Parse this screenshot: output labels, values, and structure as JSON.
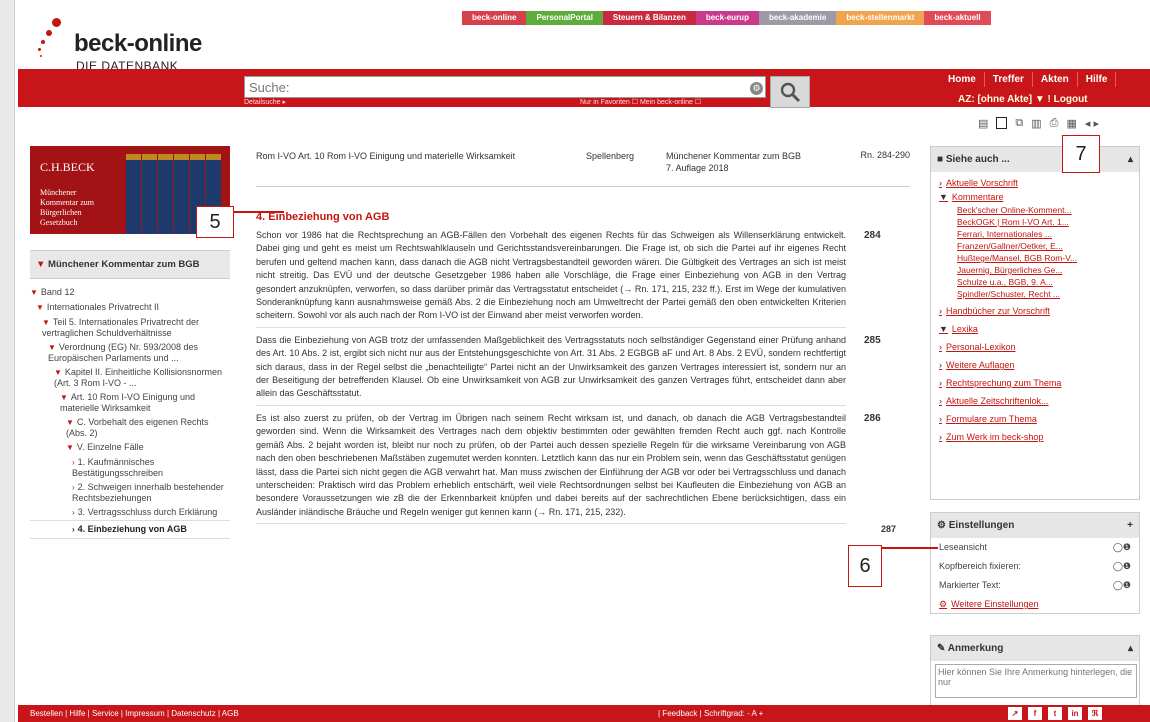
{
  "logo": {
    "title": "beck-online",
    "subtitle": "DIE DATENBANK"
  },
  "topnav": [
    {
      "label": "beck-online",
      "color": "#d6404a"
    },
    {
      "label": "PersonalPortal",
      "color": "#5cad3b"
    },
    {
      "label": "Steuern & Bilanzen",
      "color": "#c92a3f"
    },
    {
      "label": "beck-eurup",
      "color": "#c93a8a"
    },
    {
      "label": "beck-akademie",
      "color": "#9c9aa6"
    },
    {
      "label": "beck-stellenmarkt",
      "color": "#f0a44e"
    },
    {
      "label": "beck-aktuell",
      "color": "#e14a57"
    }
  ],
  "search": {
    "placeholder": "Suche:",
    "detail": "Detailsuche ▸",
    "options": "Nur in Favoriten ☐   Mein beck-online ☐"
  },
  "rightnav": {
    "items": [
      "Home",
      "Treffer",
      "Akten",
      "Hilfe"
    ],
    "akte": "AZ: [ohne Akte]  ▼  !  Logout"
  },
  "book": {
    "brand": "C.H.BECK",
    "desc": "Münchener Kommentar zum Bürgerlichen Gesetzbuch"
  },
  "tree": {
    "head": "Münchener Kommentar zum BGB",
    "items": [
      {
        "c": "▼",
        "label": "Band 12",
        "indent": 0
      },
      {
        "c": "▼",
        "label": "Internationales Privatrecht II",
        "indent": 6
      },
      {
        "c": "▼",
        "label": "Teil 5. Internationales Privatrecht der vertraglichen Schuldverhältnisse",
        "indent": 12
      },
      {
        "c": "▼",
        "label": "Verordnung (EG) Nr. 593/2008 des Europäischen Parlaments und ...",
        "indent": 18
      },
      {
        "c": "▼",
        "label": "Kapitel II. Einheitliche Kollisionsnormen (Art. 3 Rom I-VO - ...",
        "indent": 24
      },
      {
        "c": "▼",
        "label": "Art. 10 Rom I-VO Einigung und materielle Wirksamkeit",
        "indent": 30
      },
      {
        "c": "▼",
        "label": "C. Vorbehalt des eigenen Rechts (Abs. 2)",
        "indent": 36
      },
      {
        "c": "▼",
        "label": "V. Einzelne Fälle",
        "indent": 36
      },
      {
        "c": "›",
        "label": "1. Kaufmännisches Bestätigungsschreiben",
        "indent": 42
      },
      {
        "c": "›",
        "label": "2. Schweigen innerhalb bestehender Rechtsbeziehungen",
        "indent": 42
      },
      {
        "c": "›",
        "label": "3. Vertragsschluss durch Erklärung",
        "indent": 42
      }
    ],
    "last": "4. Einbeziehung von AGB"
  },
  "meta": {
    "title": "Rom I-VO Art. 10 Rom I-VO Einigung und materielle Wirksamkeit",
    "author": "Spellenberg",
    "work": "Münchener Kommentar zum BGB",
    "edition": "7. Auflage 2018",
    "rn": "Rn. 284-290"
  },
  "heading": "4. Einbeziehung von AGB",
  "paragraphs": [
    {
      "rn": "284",
      "text": "Schon vor 1986 hat die Rechtsprechung an AGB-Fällen den Vorbehalt des eigenen Rechts für das Schweigen als Willenserklärung entwickelt. Dabei ging und geht es meist um Rechtswahlklauseln und Gerichtsstandsvereinbarungen. Die Frage ist, ob sich die Partei auf ihr eigenes Recht berufen und geltend machen kann, dass danach die AGB nicht Vertragsbestandteil geworden wären. Die Gültigkeit des Vertrages an sich ist meist nicht streitig. Das EVÜ und der deutsche Gesetzgeber 1986 haben alle Vorschläge, die Frage einer Einbeziehung von AGB in den Vertrag gesondert anzuknüpfen, verworfen, so dass darüber primär das Vertragsstatut entscheidet (→ Rn. 171, 215, 232 ff.). Erst im Wege der kumulativen Sonderanknüpfung kann ausnahmsweise gemäß Abs. 2 die Einbeziehung noch am Umweltrecht der Partei gemäß den oben entwickelten Kriterien scheitern. Sowohl vor als auch nach der Rom I-VO ist der Einwand aber meist verworfen worden."
    },
    {
      "rn": "285",
      "text": "Dass die Einbeziehung von AGB trotz der umfassenden Maßgeblichkeit des Vertragsstatuts noch selbständiger Gegenstand einer Prüfung anhand des Art. 10 Abs. 2 ist, ergibt sich nicht nur aus der Entstehungsgeschichte von Art. 31 Abs. 2 EGBGB aF und Art. 8 Abs. 2 EVÜ, sondern rechtfertigt sich daraus, dass in der Regel selbst die „benachteiligte“ Partei nicht an der Unwirksamkeit des ganzen Vertrages interessiert ist, sondern nur an der Beseitigung der betreffenden Klausel. Ob eine Unwirksamkeit von AGB zur Unwirksamkeit des ganzen Vertrages führt, entscheidet dann aber allein das Geschäftsstatut."
    },
    {
      "rn": "286",
      "text": "Es ist also zuerst zu prüfen, ob der Vertrag im Übrigen nach seinem Recht wirksam ist, und danach, ob danach die AGB Vertragsbestandteil geworden sind. Wenn die Wirksamkeit des Vertrages nach dem objektiv bestimmten oder gewählten fremden Recht auch ggf. nach Kontrolle gemäß Abs. 2 bejaht worden ist, bleibt nur noch zu prüfen, ob der Partei auch dessen spezielle Regeln für die wirksame Vereinbarung von AGB nach den oben beschriebenen Maßstäben zugemutet werden konnten. Letztlich kann das nur ein Problem sein, wenn das Geschäftsstatut genügen lässt, dass die Partei sich nicht gegen die AGB verwahrt hat. Man muss zwischen der Einführung der AGB vor oder bei Vertragsschluss und danach unterscheiden: Praktisch wird das Problem erheblich entschärft, weil viele Rechtsordnungen selbst bei Kaufleuten die Einbeziehung von AGB an besondere Voraussetzungen wie zB die der Erkennbarkeit knüpfen und dabei bereits auf der sachrechtlichen Ebene berücksichtigen, dass ein Ausländer inländische Bräuche und Regeln weniger gut kennen kann (→ Rn. 171, 215, 232)."
    }
  ],
  "next_rn": "287",
  "siehe": {
    "head": "Siehe auch ...",
    "items": [
      "Aktuelle Vorschrift",
      "Kommentare"
    ],
    "kommentare": [
      "Beck'scher Online-Komment...",
      "BeckOGK | Rom I-VO Art. 1...",
      "Ferrari, Internationales ...",
      "Franzen/Gallner/Oetker, E...",
      "Hußtege/Mansel, BGB Rom-V...",
      "Jauernig, Bürgerliches Ge...",
      "Schulze u.a., BGB, 9. A...",
      "Spindler/Schuster, Recht ..."
    ],
    "items2": [
      "Handbücher zur Vorschrift",
      "Lexika",
      "Personal-Lexikon",
      "Weitere Auflagen",
      "Rechtsprechung zum Thema",
      "Aktuelle Zeitschriftenlok...",
      "Formulare zum Thema",
      "Zum Werk im beck-shop"
    ]
  },
  "einstellungen": {
    "head": "Einstellungen",
    "rows": [
      "Leseansicht",
      "Kopfbereich fixieren:",
      "Markierter Text:"
    ],
    "more": "Weitere Einstellungen"
  },
  "anmerkung": {
    "head": "Anmerkung",
    "placeholder": "Hier können Sie Ihre Anmerkung hinterlegen, die nur"
  },
  "callouts": [
    "5",
    "6",
    "7"
  ],
  "footer": {
    "left": "Bestellen  |  Hilfe  |  Service  |  Impressum  |  Datenschutz  |  AGB",
    "mid": "|  Feedback  |  Schriftgrad: - A +"
  }
}
